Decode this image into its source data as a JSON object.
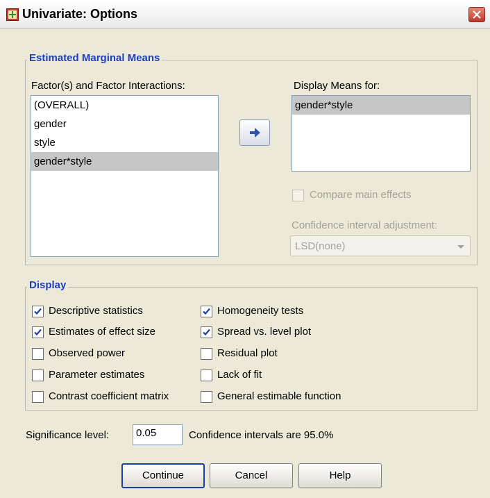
{
  "window": {
    "title": "Univariate: Options",
    "close_label": "X"
  },
  "emm": {
    "legend": "Estimated Marginal Means",
    "factors_label": "Factor(s) and Factor Interactions:",
    "factors": [
      {
        "label": "(OVERALL)",
        "selected": false
      },
      {
        "label": "gender",
        "selected": false
      },
      {
        "label": "style",
        "selected": false
      },
      {
        "label": "gender*style",
        "selected": true
      }
    ],
    "move_button_icon": "arrow-right-icon",
    "display_means_label": "Display Means for:",
    "display_means": [
      {
        "label": "gender*style",
        "selected": true
      }
    ],
    "compare_main_effects": {
      "label": "Compare main effects",
      "checked": false,
      "enabled": false
    },
    "ci_adjustment_label": "Confidence interval adjustment:",
    "ci_adjustment_value": "LSD(none)"
  },
  "display": {
    "legend": "Display",
    "options": [
      {
        "label": "Descriptive statistics",
        "checked": true,
        "enabled": true
      },
      {
        "label": "Homogeneity tests",
        "checked": true,
        "enabled": true
      },
      {
        "label": "Estimates of effect size",
        "checked": true,
        "enabled": true
      },
      {
        "label": "Spread vs. level plot",
        "checked": true,
        "enabled": true
      },
      {
        "label": "Observed power",
        "checked": false,
        "enabled": true
      },
      {
        "label": "Residual plot",
        "checked": false,
        "enabled": true
      },
      {
        "label": "Parameter estimates",
        "checked": false,
        "enabled": true
      },
      {
        "label": "Lack of fit",
        "checked": false,
        "enabled": true
      },
      {
        "label": "Contrast coefficient matrix",
        "checked": false,
        "enabled": true
      },
      {
        "label": "General estimable function",
        "checked": false,
        "enabled": true
      }
    ]
  },
  "significance": {
    "label": "Significance level:",
    "value": "0.05",
    "ci_text": "Confidence intervals are 95.0%"
  },
  "buttons": {
    "continue": "Continue",
    "cancel": "Cancel",
    "help": "Help"
  },
  "colors": {
    "legend_text": "#1c3fbf",
    "selection": "#c6c6c6",
    "dialog_bg": "#ECE9D8",
    "close_button": "#c2362b"
  }
}
